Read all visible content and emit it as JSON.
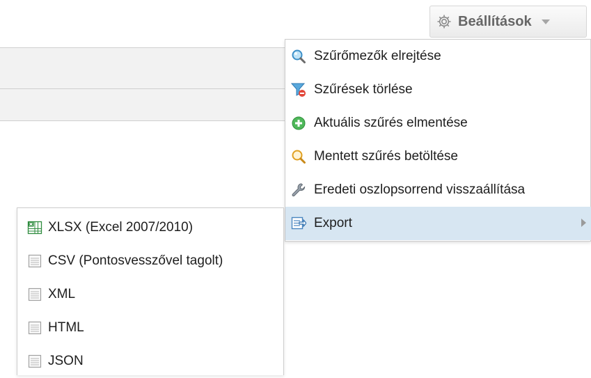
{
  "settings_button": {
    "label": "Beállítások",
    "icon": "gear-icon"
  },
  "menu": {
    "items": [
      {
        "label": "Szűrőmezők elrejtése",
        "icon": "magnifier-icon"
      },
      {
        "label": "Szűrések törlése",
        "icon": "filter-remove-icon"
      },
      {
        "label": "Aktuális szűrés elmentése",
        "icon": "add-circle-icon"
      },
      {
        "label": "Mentett szűrés betöltése",
        "icon": "search-icon"
      },
      {
        "label": "Eredeti oszlopsorrend visszaállítása",
        "icon": "wrench-icon"
      },
      {
        "label": "Export",
        "icon": "export-icon",
        "highlighted": true,
        "has_submenu": true
      }
    ]
  },
  "export_submenu": {
    "items": [
      {
        "label": "XLSX (Excel 2007/2010)",
        "icon": "excel-file-icon"
      },
      {
        "label": "CSV (Pontosvesszővel tagolt)",
        "icon": "document-icon"
      },
      {
        "label": "XML",
        "icon": "document-icon"
      },
      {
        "label": "HTML",
        "icon": "document-icon"
      },
      {
        "label": "JSON",
        "icon": "document-icon"
      }
    ]
  },
  "colors": {
    "highlight": "#d7e6f2",
    "menu_border": "#cdcdcd",
    "button_text": "#666666"
  }
}
